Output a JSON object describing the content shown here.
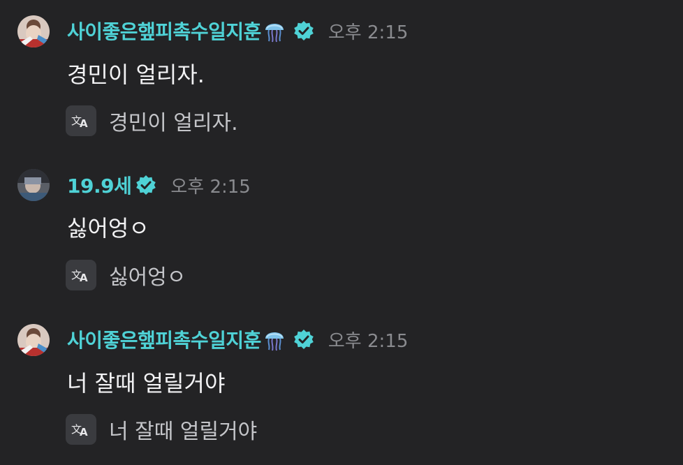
{
  "messages": [
    {
      "username": "사이좋은햎피촉수일지훈",
      "emoji_icon": "jellyfish-icon",
      "verified": true,
      "timestamp": "오후 2:15",
      "text": "경민이 얼리자.",
      "translation": "경민이 얼리자."
    },
    {
      "username": "19.9세",
      "verified": true,
      "timestamp": "오후 2:15",
      "text": "싫어엉ㅇ",
      "translation": "싫어엉ㅇ"
    },
    {
      "username": "사이좋은햎피촉수일지훈",
      "emoji_icon": "jellyfish-icon",
      "verified": true,
      "timestamp": "오후 2:15",
      "text": "너 잘때 얼릴거야",
      "translation": "너 잘때 얼릴거야"
    }
  ],
  "colors": {
    "background": "#232325",
    "username": "#4fd2d6",
    "verified_badge": "#4fd2d6",
    "timestamp": "#8a8b8f",
    "message_text": "#f2f2f4",
    "translation_text": "#c4c5c9",
    "translate_button_bg": "#3a3b3f"
  }
}
